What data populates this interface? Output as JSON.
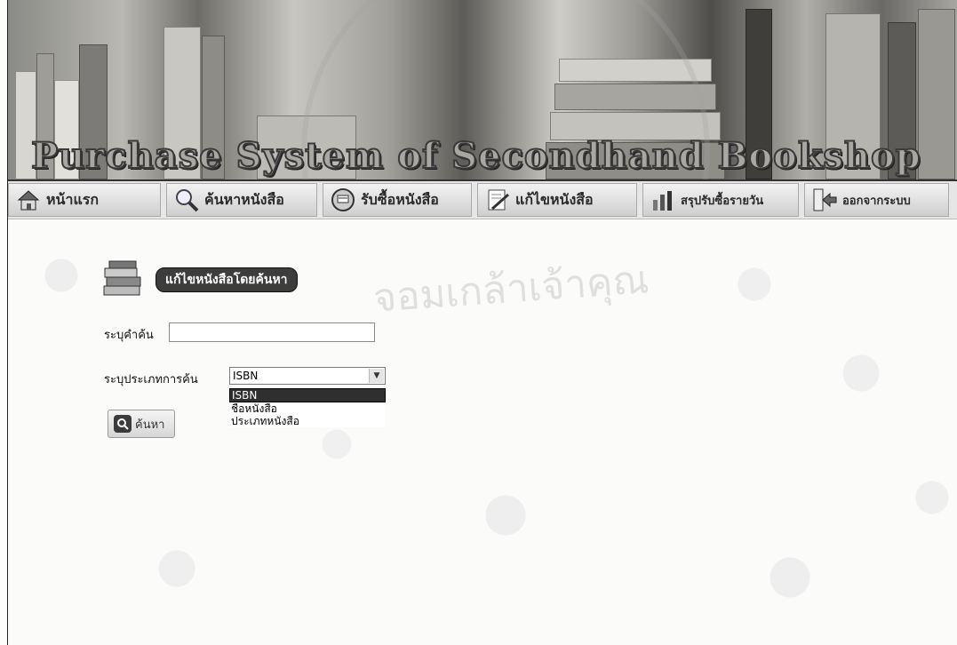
{
  "banner": {
    "title": "Purchase System of Secondhand Bookshop"
  },
  "nav": {
    "home": "หน้าแรก",
    "search_books": "ค้นหาหนังสือ",
    "buy_books": "รับซื้อหนังสือ",
    "edit_books": "แก้ไขหนังสือ",
    "daily_summary": "สรุปรับซื้อรายวัน",
    "logout": "ออกจากระบบ"
  },
  "section": {
    "title": "แก้ไขหนังสือโดยค้นหา"
  },
  "form": {
    "keyword_label": "ระบุคำค้น",
    "keyword_value": "",
    "type_label": "ระบุประเภทการค้น",
    "type_selected": "ISBN",
    "type_options": [
      "ISBN",
      "ชื่อหนังสือ",
      "ประเภทหนังสือ"
    ],
    "search_button": "ค้นหา"
  },
  "watermark": {
    "text": "จอมเกล้าเจ้าคุณ"
  }
}
